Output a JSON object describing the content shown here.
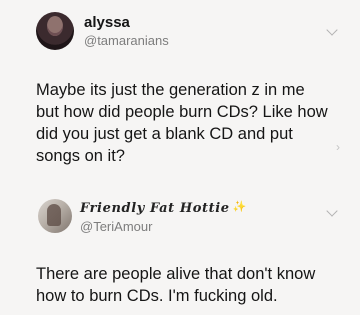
{
  "tweets": [
    {
      "display_name": "alyssa",
      "handle": "@tamaranians",
      "text_lines": [
        "Maybe its just the generation z in me",
        "but how did people burn CDs? Like how",
        "did you just get a blank CD and put",
        "songs on it?"
      ],
      "icons": {
        "menu": "chevron-down-icon",
        "avatar": "profile-photo"
      }
    },
    {
      "display_name": "Friendly Fat Hottie",
      "handle": "@TeriAmour",
      "name_decoration": "✨",
      "text_lines": [
        "There are people alive that don't know",
        "how to burn CDs. I'm fucking old."
      ],
      "icons": {
        "menu": "chevron-down-icon",
        "avatar": "profile-photo",
        "decoration": "sparkles-icon"
      }
    }
  ],
  "side_arrow": "›",
  "colors": {
    "background": "#f6f5f4",
    "text": "#151515",
    "handle": "#7d7d7d",
    "sparkle": "#f0c419"
  }
}
